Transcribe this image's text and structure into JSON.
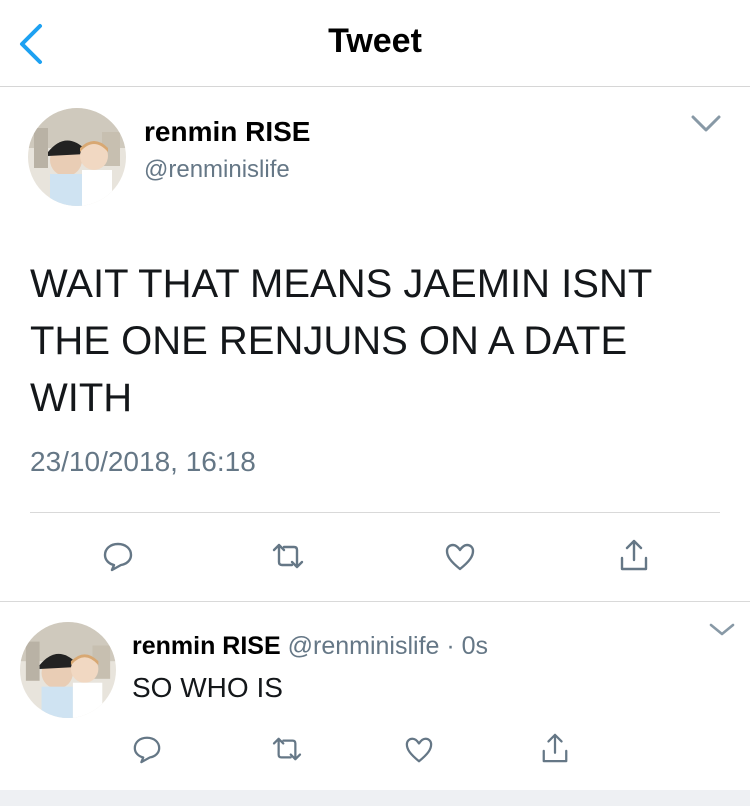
{
  "header": {
    "title": "Tweet"
  },
  "tweet": {
    "name": "renmin RISE",
    "handle": "@renminislife",
    "text_lines": [
      "WAIT THAT MEANS JAEMIN ISNT",
      "THE ONE RENJUNS ON A DATE",
      "WITH"
    ],
    "timestamp": "23/10/2018, 16:18"
  },
  "reply": {
    "name": "renmin RISE",
    "handle": "@renminislife",
    "separator": "·",
    "age": "0s",
    "text": "SO WHO IS"
  },
  "colors": {
    "accent": "#1da1f2",
    "icon_gray": "#657786",
    "divider": "#d9d9d9"
  }
}
